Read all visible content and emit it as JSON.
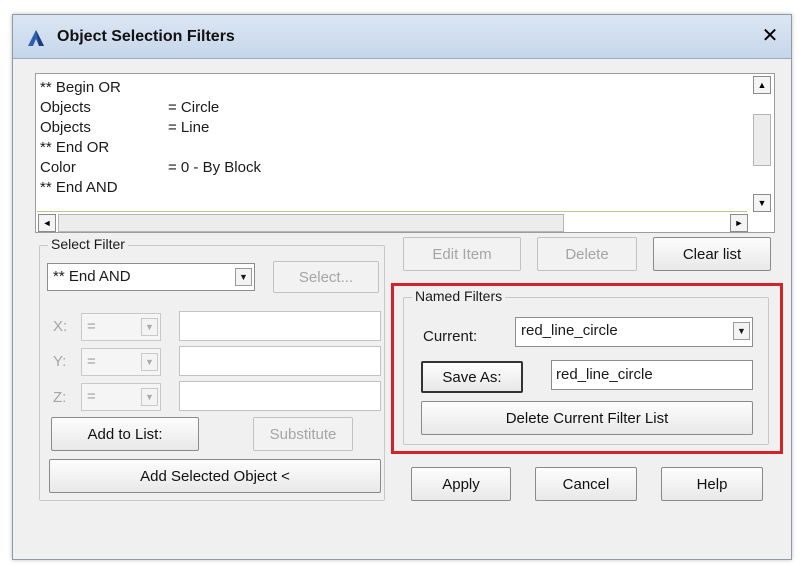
{
  "window": {
    "title": "Object Selection Filters",
    "close_symbol": "✕"
  },
  "filter_list": {
    "rows": [
      {
        "name": "** Begin OR",
        "value": ""
      },
      {
        "name": "Objects",
        "value": "= Circle"
      },
      {
        "name": "Objects",
        "value": "= Line"
      },
      {
        "name": "** End OR",
        "value": ""
      },
      {
        "name": "Color",
        "value": "= 0 - By Block"
      },
      {
        "name": "** End AND",
        "value": ""
      }
    ]
  },
  "buttons": {
    "edit_item": "Edit Item",
    "delete": "Delete",
    "clear_list": "Clear list",
    "apply": "Apply",
    "cancel": "Cancel",
    "help": "Help"
  },
  "select_filter": {
    "label": "Select Filter",
    "current": "** End AND",
    "select_button": "Select...",
    "x": {
      "label": "X:",
      "operator": "="
    },
    "y": {
      "label": "Y:",
      "operator": "="
    },
    "z": {
      "label": "Z:",
      "operator": "="
    },
    "add_to_list": "Add to List:",
    "substitute": "Substitute",
    "add_selected_object": "Add Selected Object <"
  },
  "named_filters": {
    "label": "Named Filters",
    "current_label": "Current:",
    "current_value": "red_line_circle",
    "save_as_button": "Save As:",
    "save_as_value": "red_line_circle",
    "delete_button": "Delete Current Filter List"
  },
  "colors": {
    "highlight": "#d2232a",
    "titlebar": "#c6d6ea"
  },
  "icons": {
    "app": "autocad-icon",
    "dropdown": "triangle-down"
  }
}
